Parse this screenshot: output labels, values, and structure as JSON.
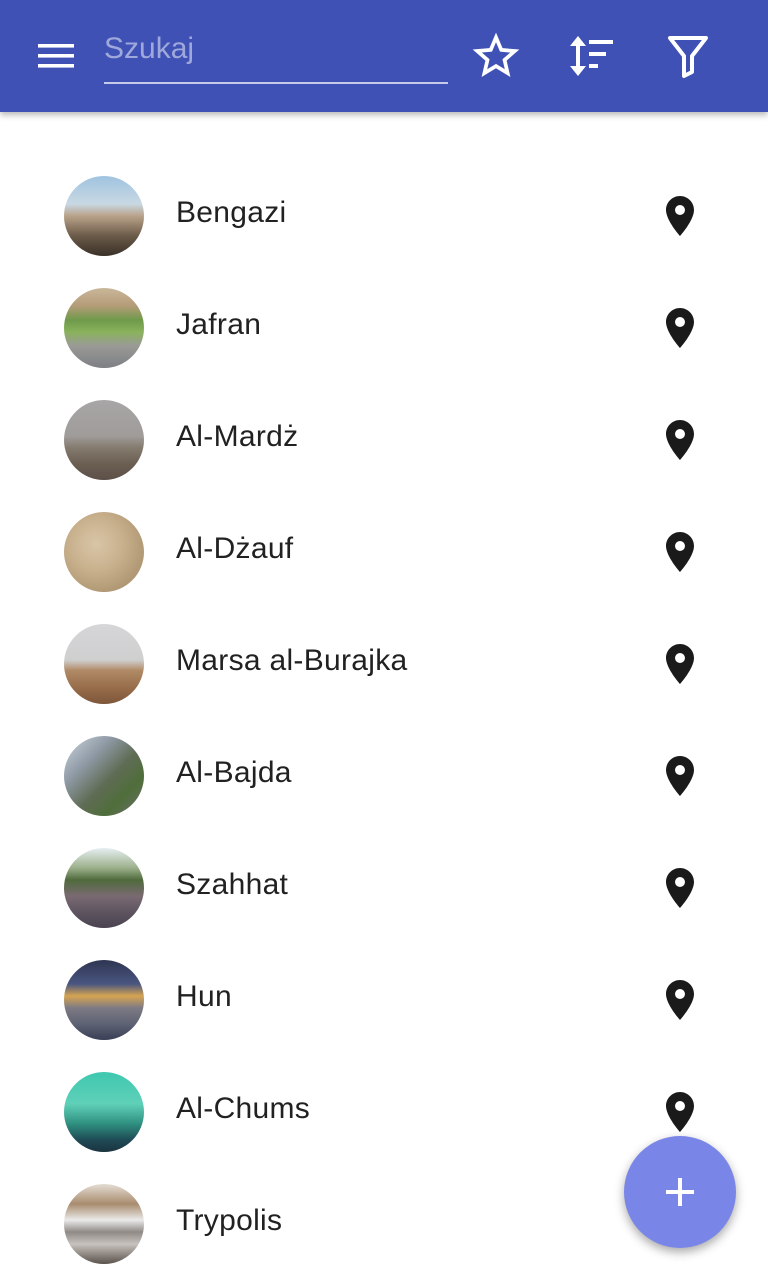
{
  "toolbar": {
    "menu_icon": "menu-icon",
    "search_placeholder": "Szukaj",
    "search_value": "",
    "favorite_icon": "star-outline-icon",
    "sort_icon": "sort-icon",
    "filter_icon": "filter-icon",
    "background_color": "#3f51b5"
  },
  "places": [
    {
      "name": "Bengazi",
      "thumbnail": "city-skyline-photo"
    },
    {
      "name": "Jafran",
      "thumbnail": "collage-photo"
    },
    {
      "name": "Al-Mardż",
      "thumbnail": "road-photo"
    },
    {
      "name": "Al-Dżauf",
      "thumbnail": "aerial-photo"
    },
    {
      "name": "Marsa al-Burajka",
      "thumbnail": "desert-photo"
    },
    {
      "name": "Al-Bajda",
      "thumbnail": "street-photo"
    },
    {
      "name": "Szahhat",
      "thumbnail": "square-photo"
    },
    {
      "name": "Hun",
      "thumbnail": "night-town-photo"
    },
    {
      "name": "Al-Chums",
      "thumbnail": "monument-photo"
    },
    {
      "name": "Trypolis",
      "thumbnail": "buildings-collage-photo"
    }
  ],
  "row_icon": "map-pin-icon",
  "fab": {
    "icon": "plus-icon",
    "color": "#7986e8"
  }
}
